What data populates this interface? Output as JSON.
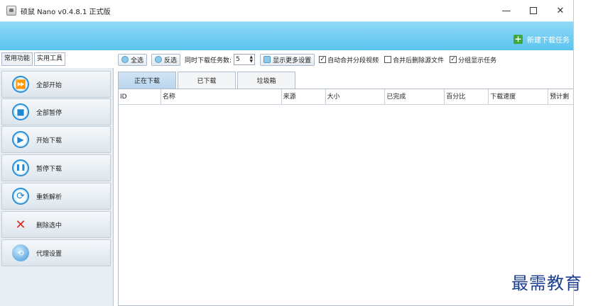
{
  "window": {
    "title": "硕鼠 Nano v0.4.8.1 正式版",
    "controls": {
      "minimize": "—",
      "close": "✕"
    }
  },
  "header": {
    "new_task_label": "新建下载任务",
    "new_task_icon": "plus-icon"
  },
  "left_tabs": [
    {
      "label": "常用功能",
      "active": false
    },
    {
      "label": "实用工具",
      "active": true
    }
  ],
  "sidebar": {
    "items": [
      {
        "label": "全部开始",
        "icon": "fast-forward-icon",
        "glyph": "⏩"
      },
      {
        "label": "全部暂停",
        "icon": "stop-icon",
        "glyph": "■"
      },
      {
        "label": "开始下载",
        "icon": "play-icon",
        "glyph": "▶"
      },
      {
        "label": "暂停下载",
        "icon": "pause-icon",
        "glyph": "❚❚"
      },
      {
        "label": "重新解析",
        "icon": "refresh-icon",
        "glyph": "⟳"
      },
      {
        "label": "删除选中",
        "icon": "delete-icon",
        "glyph": "✕"
      },
      {
        "label": "代理设置",
        "icon": "globe-icon",
        "glyph": "⟲"
      }
    ]
  },
  "toolbar": {
    "select_all": "全选",
    "invert_select": "反选",
    "concurrent_label": "同时下载任务数:",
    "concurrent_value": "5",
    "more_settings": "显示更多设置",
    "auto_merge": {
      "label": "自动合并分段视频",
      "checked": true
    },
    "delete_source": {
      "label": "合并后删除源文件",
      "checked": false
    },
    "group_display": {
      "label": "分组显示任务",
      "checked": true
    }
  },
  "content_tabs": [
    {
      "label": "正在下载",
      "active": true
    },
    {
      "label": "已下载",
      "active": false
    },
    {
      "label": "垃圾箱",
      "active": false
    }
  ],
  "table": {
    "columns": [
      "ID",
      "名称",
      "来源",
      "大小",
      "已完成",
      "百分比",
      "下载速度",
      "预计剩"
    ]
  },
  "watermark": "最需教育",
  "colors": {
    "header_blue": "#5cc4ee",
    "accent_green": "#3ea83e",
    "icon_blue": "#2a8fd6",
    "delete_red": "#e02a1f"
  }
}
